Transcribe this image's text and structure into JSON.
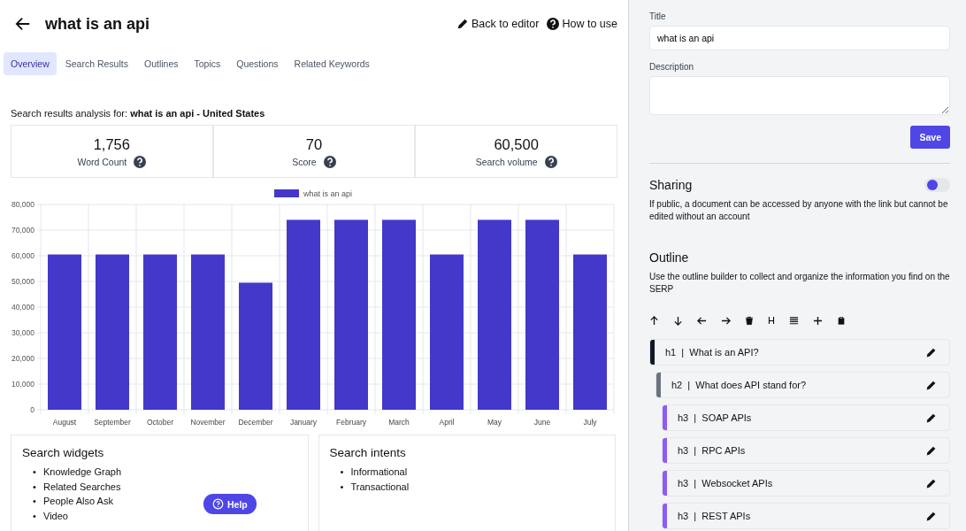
{
  "header": {
    "title": "what is an api",
    "actions": [
      {
        "kind": "edit",
        "label": "Back to editor"
      },
      {
        "kind": "help",
        "label": "How to use"
      }
    ]
  },
  "tabs": [
    {
      "label": "Overview",
      "selected": true
    },
    {
      "label": "Search Results",
      "selected": false
    },
    {
      "label": "Outlines",
      "selected": false
    },
    {
      "label": "Topics",
      "selected": false
    },
    {
      "label": "Questions",
      "selected": false
    },
    {
      "label": "Related Keywords",
      "selected": false
    }
  ],
  "analysis": {
    "text": "Search results analysis for: **what is an api - United States**"
  },
  "stats": [
    {
      "value": "1,756",
      "label": "Word Count"
    },
    {
      "value": "70",
      "label": "Score"
    },
    {
      "value": "60,500",
      "label": "Search volume"
    }
  ],
  "chart_data": {
    "type": "bar",
    "categories": [
      "August",
      "September",
      "October",
      "November",
      "December",
      "January",
      "February",
      "March",
      "April",
      "May",
      "June",
      "July"
    ],
    "series": [
      {
        "name": "what is an api",
        "color": "#4338ca",
        "values": [
          60500,
          60500,
          60500,
          60500,
          49500,
          74000,
          74000,
          74000,
          60500,
          74000,
          74000,
          60500
        ]
      }
    ],
    "grid": true,
    "ylim": [
      0,
      80000
    ],
    "yticks": [
      {
        "value": 0,
        "label": "0"
      },
      {
        "value": 10000,
        "label": "10,000"
      },
      {
        "value": 20000,
        "label": "20,000"
      },
      {
        "value": 30000,
        "label": "30,000"
      },
      {
        "value": 40000,
        "label": "40,000"
      },
      {
        "value": 50000,
        "label": "50,000"
      },
      {
        "value": 60000,
        "label": "60,000"
      },
      {
        "value": 70000,
        "label": "70,000"
      },
      {
        "value": 80000,
        "label": "80,000"
      }
    ]
  },
  "panels": [
    {
      "title": "Search widgets",
      "items": [
        {
          "bullet": "•",
          "text": "Knowledge Graph"
        },
        {
          "bullet": "•",
          "text": "Related Searches"
        },
        {
          "bullet": "•",
          "text": "People Also Ask"
        },
        {
          "bullet": "•",
          "text": "Video"
        }
      ]
    },
    {
      "title": "Search intents",
      "items": [
        {
          "bullet": "•",
          "text": "Informational"
        },
        {
          "bullet": "•",
          "text": "Transactional"
        }
      ]
    }
  ],
  "help_button": {
    "label": "Help"
  },
  "sidebar": {
    "title_label": "Title",
    "title_value": "what is an api",
    "description_label": "Description",
    "save": "Save",
    "sharing": {
      "heading": "Sharing",
      "on": false,
      "text": "If public, a document can be accessed by anyone with the link but cannot be edited without an account"
    },
    "outline": {
      "heading": "Outline",
      "text": "Use the outline builder to collect and organize the information you find on the SERP",
      "tools": [
        {
          "kind": "up"
        },
        {
          "kind": "down"
        },
        {
          "kind": "left"
        },
        {
          "kind": "right"
        },
        {
          "kind": "delete"
        },
        {
          "kind": "heading",
          "label": "H"
        },
        {
          "kind": "paragraph"
        },
        {
          "kind": "add"
        },
        {
          "kind": "paste"
        }
      ],
      "items": [
        {
          "text": "h1  |  What is an API?",
          "children": [
            {
              "text": "h2  |  What does API stand for?",
              "children": [
                {
                  "text": "h3  |  SOAP APIs"
                },
                {
                  "text": "h3  |  RPC APIs"
                },
                {
                  "text": "h3  |  Websocket APIs"
                },
                {
                  "text": "h3  |  REST APIs"
                }
              ]
            }
          ]
        }
      ]
    }
  }
}
